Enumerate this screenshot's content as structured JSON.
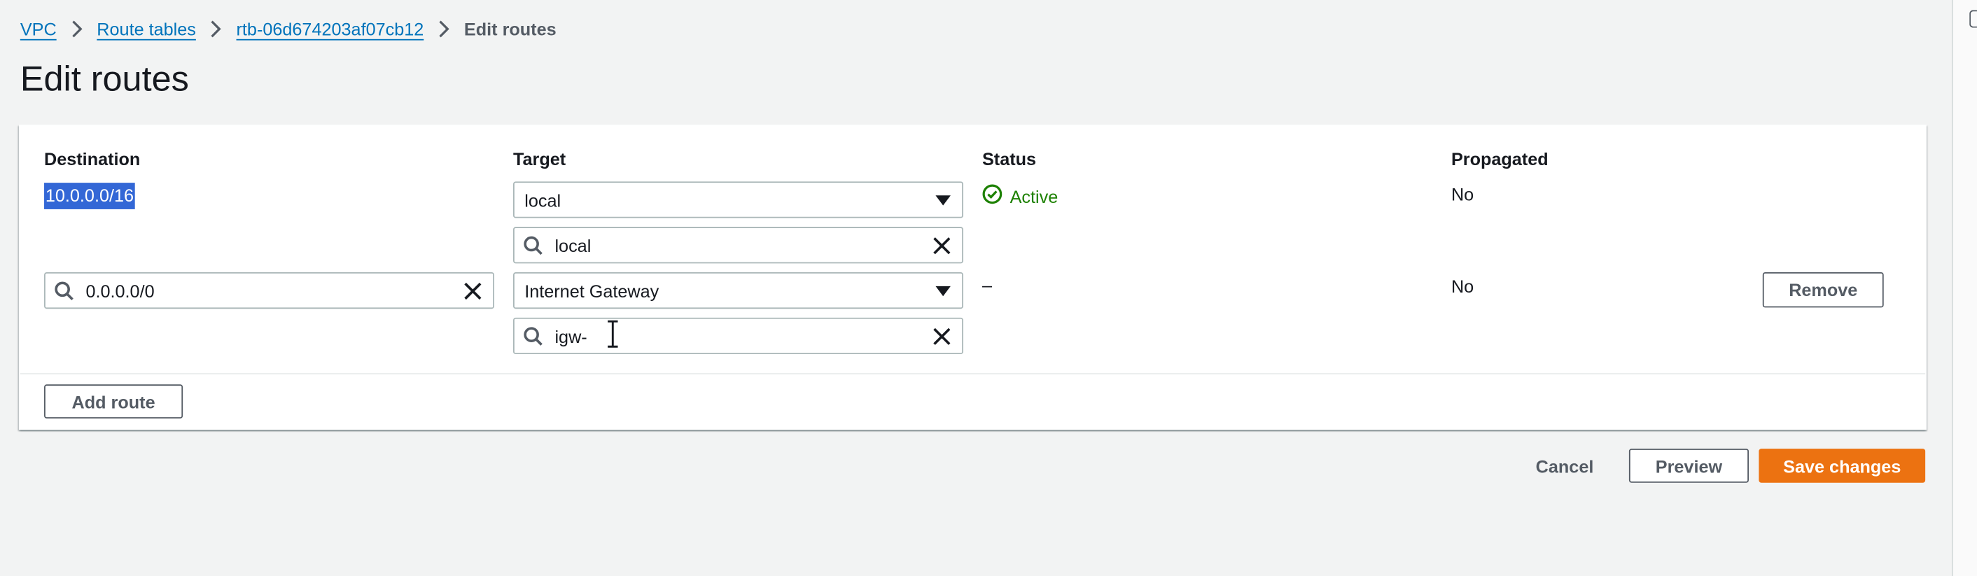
{
  "breadcrumb": {
    "items": [
      "VPC",
      "Route tables",
      "rtb-06d674203af07cb12"
    ],
    "current": "Edit routes"
  },
  "page": {
    "title": "Edit routes"
  },
  "table": {
    "headers": {
      "destination": "Destination",
      "target": "Target",
      "status": "Status",
      "propagated": "Propagated"
    },
    "rows": [
      {
        "destination": "10.0.0.0/16",
        "target_select": "local",
        "target_search": "local",
        "status": "Active",
        "propagated": "No"
      },
      {
        "destination": "0.0.0.0/0",
        "target_select": "Internet Gateway",
        "target_search": "igw-",
        "status": "–",
        "propagated": "No",
        "remove_label": "Remove"
      }
    ]
  },
  "actions": {
    "add_route": "Add route",
    "cancel": "Cancel",
    "preview": "Preview",
    "save": "Save changes"
  },
  "icons": {
    "chevron": "chevron-right-icon",
    "caret": "caret-down-icon",
    "search": "search-icon",
    "clear": "close-icon",
    "status": "check-circle-icon"
  },
  "colors": {
    "link": "#0073bb",
    "success": "#1d8102",
    "primary": "#ec7211",
    "selection": "#3367d6"
  }
}
